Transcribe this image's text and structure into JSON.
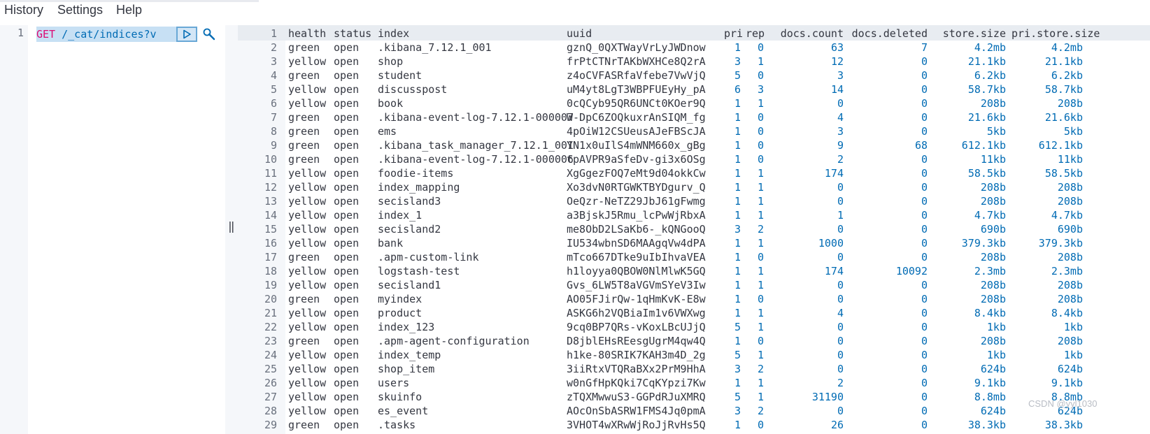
{
  "menu": [
    "History",
    "Settings",
    "Help"
  ],
  "editor": {
    "line_number": "1",
    "method": "GET",
    "path": " /_cat/indices?v"
  },
  "output": {
    "header": {
      "ln": "1",
      "health": "health",
      "status": "status",
      "index": "index",
      "uuid": "uuid",
      "pri": "pri",
      "rep": "rep",
      "docs": "docs.count",
      "del": "docs.deleted",
      "size": "store.size",
      "psize": "pri.store.size"
    },
    "rows": [
      [
        "2",
        "green",
        "open",
        ".kibana_7.12.1_001",
        "gznQ_0QXTWayVrLyJWDnow",
        "1",
        "0",
        "63",
        "7",
        "4.2mb",
        "4.2mb"
      ],
      [
        "3",
        "yellow",
        "open",
        "shop",
        "frPtCTNrTAKbWXHCe8Q2rA",
        "3",
        "1",
        "12",
        "0",
        "21.1kb",
        "21.1kb"
      ],
      [
        "4",
        "green",
        "open",
        "student",
        "z4oCVFASRfaVfebe7VwVjQ",
        "5",
        "0",
        "3",
        "0",
        "6.2kb",
        "6.2kb"
      ],
      [
        "5",
        "yellow",
        "open",
        "discusspost",
        "uM4yt8LgT3WBPFUEyHy_pA",
        "6",
        "3",
        "14",
        "0",
        "58.7kb",
        "58.7kb"
      ],
      [
        "6",
        "yellow",
        "open",
        "book",
        "0cQCyb95QR6UNCt0KOer9Q",
        "1",
        "1",
        "0",
        "0",
        "208b",
        "208b"
      ],
      [
        "7",
        "green",
        "open",
        ".kibana-event-log-7.12.1-000007",
        "W-DpC6ZOQkuxrAnSIQM_fg",
        "1",
        "0",
        "4",
        "0",
        "21.6kb",
        "21.6kb"
      ],
      [
        "8",
        "green",
        "open",
        "ems",
        "4pOiW12CSUeusAJeFBScJA",
        "1",
        "0",
        "3",
        "0",
        "5kb",
        "5kb"
      ],
      [
        "9",
        "green",
        "open",
        ".kibana_task_manager_7.12.1_001",
        "YN1x0uIlS4mWNM660x_gBg",
        "1",
        "0",
        "9",
        "68",
        "612.1kb",
        "612.1kb"
      ],
      [
        "10",
        "green",
        "open",
        ".kibana-event-log-7.12.1-000006",
        "tpAVPR9aSfeDv-gi3x6OSg",
        "1",
        "0",
        "2",
        "0",
        "11kb",
        "11kb"
      ],
      [
        "11",
        "yellow",
        "open",
        "foodie-items",
        "XgGgezFOQ7eMt9d04okkCw",
        "1",
        "1",
        "174",
        "0",
        "58.5kb",
        "58.5kb"
      ],
      [
        "12",
        "yellow",
        "open",
        "index_mapping",
        "Xo3dvN0RTGWKTBYDgurv_Q",
        "1",
        "1",
        "0",
        "0",
        "208b",
        "208b"
      ],
      [
        "13",
        "yellow",
        "open",
        "secisland3",
        "OeQzr-NeTZ29JbJ61gFwmg",
        "1",
        "1",
        "0",
        "0",
        "208b",
        "208b"
      ],
      [
        "14",
        "yellow",
        "open",
        "index_1",
        "a3BjskJ5Rmu_lcPwWjRbxA",
        "1",
        "1",
        "1",
        "0",
        "4.7kb",
        "4.7kb"
      ],
      [
        "15",
        "yellow",
        "open",
        "secisland2",
        "me8ObD2LSaKb6-_kQNGooQ",
        "3",
        "2",
        "0",
        "0",
        "690b",
        "690b"
      ],
      [
        "16",
        "yellow",
        "open",
        "bank",
        "IU534wbnSD6MAAgqVw4dPA",
        "1",
        "1",
        "1000",
        "0",
        "379.3kb",
        "379.3kb"
      ],
      [
        "17",
        "green",
        "open",
        ".apm-custom-link",
        "mTco667DTke9uIbIhvaVEA",
        "1",
        "0",
        "0",
        "0",
        "208b",
        "208b"
      ],
      [
        "18",
        "yellow",
        "open",
        "logstash-test",
        "h1loyya0QBOW0NlMlwK5GQ",
        "1",
        "1",
        "174",
        "10092",
        "2.3mb",
        "2.3mb"
      ],
      [
        "19",
        "yellow",
        "open",
        "secisland1",
        "Gvs_6LW5T8aVGVmSYeV3Iw",
        "1",
        "1",
        "0",
        "0",
        "208b",
        "208b"
      ],
      [
        "20",
        "green",
        "open",
        "myindex",
        "AO05FJirQw-1qHmKvK-E8w",
        "1",
        "0",
        "0",
        "0",
        "208b",
        "208b"
      ],
      [
        "21",
        "yellow",
        "open",
        "product",
        "ASKG6h2VQBiaIm1v6VWXwg",
        "1",
        "1",
        "4",
        "0",
        "8.4kb",
        "8.4kb"
      ],
      [
        "22",
        "yellow",
        "open",
        "index_123",
        "9cq0BP7QRs-vKoxLBcUJjQ",
        "5",
        "1",
        "0",
        "0",
        "1kb",
        "1kb"
      ],
      [
        "23",
        "green",
        "open",
        ".apm-agent-configuration",
        "D8jblEHsREesgUgrM4qw4Q",
        "1",
        "0",
        "0",
        "0",
        "208b",
        "208b"
      ],
      [
        "24",
        "yellow",
        "open",
        "index_temp",
        "h1ke-80SRIK7KAH3m4D_2g",
        "5",
        "1",
        "0",
        "0",
        "1kb",
        "1kb"
      ],
      [
        "25",
        "yellow",
        "open",
        "shop_item",
        "3iiRtxVTQRaBXx2PrM9HhA",
        "3",
        "2",
        "0",
        "0",
        "624b",
        "624b"
      ],
      [
        "26",
        "yellow",
        "open",
        "users",
        "w0nGfHpKQki7CqKYpzi7Kw",
        "1",
        "1",
        "2",
        "0",
        "9.1kb",
        "9.1kb"
      ],
      [
        "27",
        "yellow",
        "open",
        "skuinfo",
        "zTQXMwwuS3-GGPdRJuXMRQ",
        "5",
        "1",
        "31190",
        "0",
        "8.8mb",
        "8.8mb"
      ],
      [
        "28",
        "yellow",
        "open",
        "es_event",
        "AOcOnSbASRW1FMS4Jq0pmA",
        "3",
        "2",
        "0",
        "0",
        "624b",
        "624b"
      ],
      [
        "29",
        "green",
        "open",
        ".tasks",
        "3VHOT4wXRwWjRoJjRvHs5Q",
        "1",
        "0",
        "26",
        "0",
        "38.3kb",
        "38.3kb"
      ]
    ]
  },
  "watermark": "CSDN @yyl1030",
  "icons": {
    "run": "play-icon",
    "wrench": "wrench-icon",
    "grip": "drag-handle-icon"
  },
  "colors": {
    "number": "#006bb4",
    "method": "#dd0a73",
    "selection": "#c7e0f4"
  }
}
